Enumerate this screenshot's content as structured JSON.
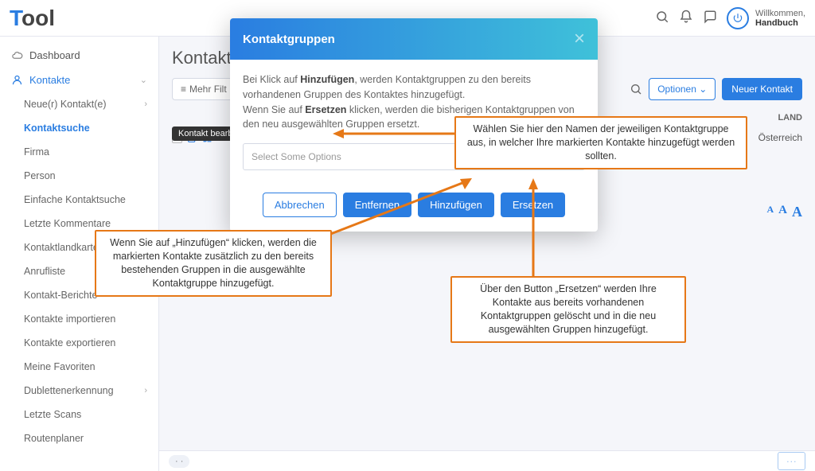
{
  "brand": {
    "pre": "T",
    "rest": "ool"
  },
  "topbar": {
    "welcome_label": "Willkommen,",
    "user": "Handbuch"
  },
  "sidebar": {
    "items": [
      {
        "label": "Dashboard",
        "icon": "cloud"
      },
      {
        "label": "Kontakte",
        "icon": "user",
        "expandable": true,
        "open": true
      },
      {
        "label": "Neue(r) Kontakt(e)",
        "sub": true,
        "expandable": true
      },
      {
        "label": "Kontaktsuche",
        "sub": true,
        "active": true
      },
      {
        "label": "Firma",
        "sub": true
      },
      {
        "label": "Person",
        "sub": true
      },
      {
        "label": "Einfache Kontaktsuche",
        "sub": true
      },
      {
        "label": "Letzte Kommentare",
        "sub": true
      },
      {
        "label": "Kontaktlandkarte",
        "sub": true
      },
      {
        "label": "Anrufliste",
        "sub": true
      },
      {
        "label": "Kontakt-Berichte",
        "sub": true
      },
      {
        "label": "Kontakte importieren",
        "sub": true
      },
      {
        "label": "Kontakte exportieren",
        "sub": true
      },
      {
        "label": "Meine Favoriten",
        "sub": true
      },
      {
        "label": "Dublettenerkennung",
        "sub": true,
        "expandable": true
      },
      {
        "label": "Letzte Scans",
        "sub": true
      },
      {
        "label": "Routenplaner",
        "sub": true
      }
    ]
  },
  "page": {
    "title_prefix": "Kontakts",
    "filter_label": "Mehr Filt",
    "options_label": "Optionen",
    "new_label": "Neuer Kontakt",
    "tooltip": "Kontakt bearb",
    "table": {
      "header_land": "LAND",
      "row_country": "Österreich"
    }
  },
  "modal": {
    "title": "Kontaktgruppen",
    "help_pre1": "Bei Klick auf ",
    "help_b1": "Hinzufügen",
    "help_post1": ", werden Kontaktgruppen zu den bereits vorhandenen Gruppen des Kontaktes hinzugefügt.",
    "help_pre2": "Wenn Sie auf ",
    "help_b2": "Ersetzen",
    "help_post2": " klicken, werden die bisherigen Kontaktgruppen von den neu ausgewählten Gruppen ersetzt.",
    "select_placeholder": "Select Some Options",
    "btn_cancel": "Abbrechen",
    "btn_remove": "Entfernen",
    "btn_add": "Hinzufügen",
    "btn_replace": "Ersetzen"
  },
  "annotations": {
    "a1": "Wählen Sie hier den Namen der jeweiligen Kontaktgruppe aus, in welcher Ihre markierten Kontakte hinzugefügt werden sollten.",
    "a2": "Wenn Sie auf „Hinzufügen“ klicken, werden die markierten Kontakte zusätzlich zu den bereits bestehenden Gruppen in die ausgewählte Kontaktgruppe hinzugefügt.",
    "a3": "Über den Button „Ersetzen“ werden Ihre Kontakte aus bereits vorhandenen Kontaktgruppen gelöscht und in die neu ausgewählten Gruppen hinzugefügt."
  }
}
